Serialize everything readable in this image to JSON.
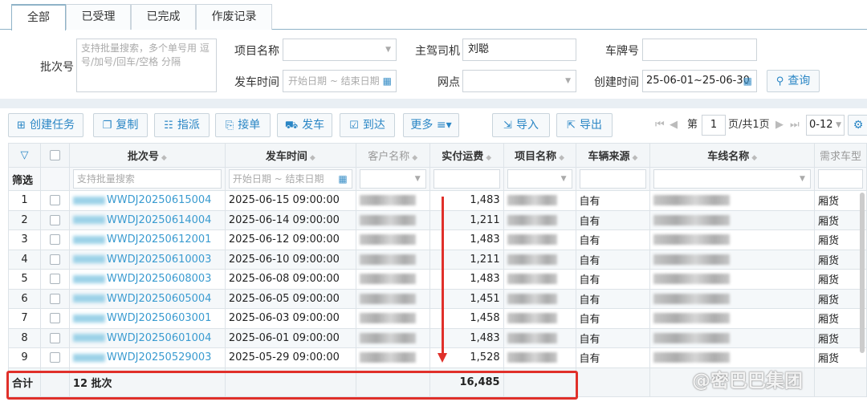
{
  "tabs": [
    "全部",
    "已受理",
    "已完成",
    "作废记录"
  ],
  "filters": {
    "batch_label": "批次号",
    "batch_placeholder": "支持批量搜索，多个单号用 逗号/加号/回车/空格 分隔",
    "project_label": "项目名称",
    "project_value": "",
    "driver_label": "主驾司机",
    "driver_value": "刘聪",
    "plate_label": "车牌号",
    "plate_value": "",
    "depart_label": "发车时间",
    "depart_placeholder": "开始日期 ~ 结束日期",
    "site_label": "网点",
    "site_value": "",
    "created_label": "创建时间",
    "created_value": "25-06-01~25-06-30",
    "search_button": "查询"
  },
  "toolbar": {
    "create": "创建任务",
    "copy": "复制",
    "assign": "指派",
    "accept": "接单",
    "depart": "发车",
    "arrive": "到达",
    "more": "更多",
    "import": "导入",
    "export": "导出"
  },
  "pager": {
    "prefix": "第",
    "page": "1",
    "suffix": "页/共1页",
    "range": "0-12"
  },
  "table": {
    "headers": [
      "批次号",
      "发车时间",
      "客户名称",
      "实付运费",
      "项目名称",
      "车辆来源",
      "车线名称",
      "需求车型"
    ],
    "filter_label": "筛选",
    "filter_batch_placeholder": "支持批量搜索",
    "filter_date_placeholder": "开始日期 ~ 结束日期",
    "rows": [
      {
        "n": "1",
        "batch": "WWDJ20250615004",
        "time": "2025-06-15 09:00:00",
        "fee": "1,483",
        "source": "自有",
        "type": "厢货"
      },
      {
        "n": "2",
        "batch": "WWDJ20250614004",
        "time": "2025-06-14 09:00:00",
        "fee": "1,211",
        "source": "自有",
        "type": "厢货"
      },
      {
        "n": "3",
        "batch": "WWDJ20250612001",
        "time": "2025-06-12 09:00:00",
        "fee": "1,483",
        "source": "自有",
        "type": "厢货"
      },
      {
        "n": "4",
        "batch": "WWDJ20250610003",
        "time": "2025-06-10 09:00:00",
        "fee": "1,211",
        "source": "自有",
        "type": "厢货"
      },
      {
        "n": "5",
        "batch": "WWDJ20250608003",
        "time": "2025-06-08 09:00:00",
        "fee": "1,483",
        "source": "自有",
        "type": "厢货"
      },
      {
        "n": "6",
        "batch": "WWDJ20250605004",
        "time": "2025-06-05 09:00:00",
        "fee": "1,451",
        "source": "自有",
        "type": "厢货"
      },
      {
        "n": "7",
        "batch": "WWDJ20250603001",
        "time": "2025-06-03 09:00:00",
        "fee": "1,458",
        "source": "自有",
        "type": "厢货"
      },
      {
        "n": "8",
        "batch": "WWDJ20250601004",
        "time": "2025-06-01 09:00:00",
        "fee": "1,483",
        "source": "自有",
        "type": "厢货"
      },
      {
        "n": "9",
        "batch": "WWDJ20250529003",
        "time": "2025-05-29 09:00:00",
        "fee": "1,528",
        "source": "自有",
        "type": "厢货"
      }
    ],
    "total_label": "合计",
    "total_batches": "12 批次",
    "total_fee": "16,485"
  },
  "watermark": "@密巴巴集团",
  "colors": {
    "accent": "#2a86c5",
    "highlight": "#e0302a"
  }
}
